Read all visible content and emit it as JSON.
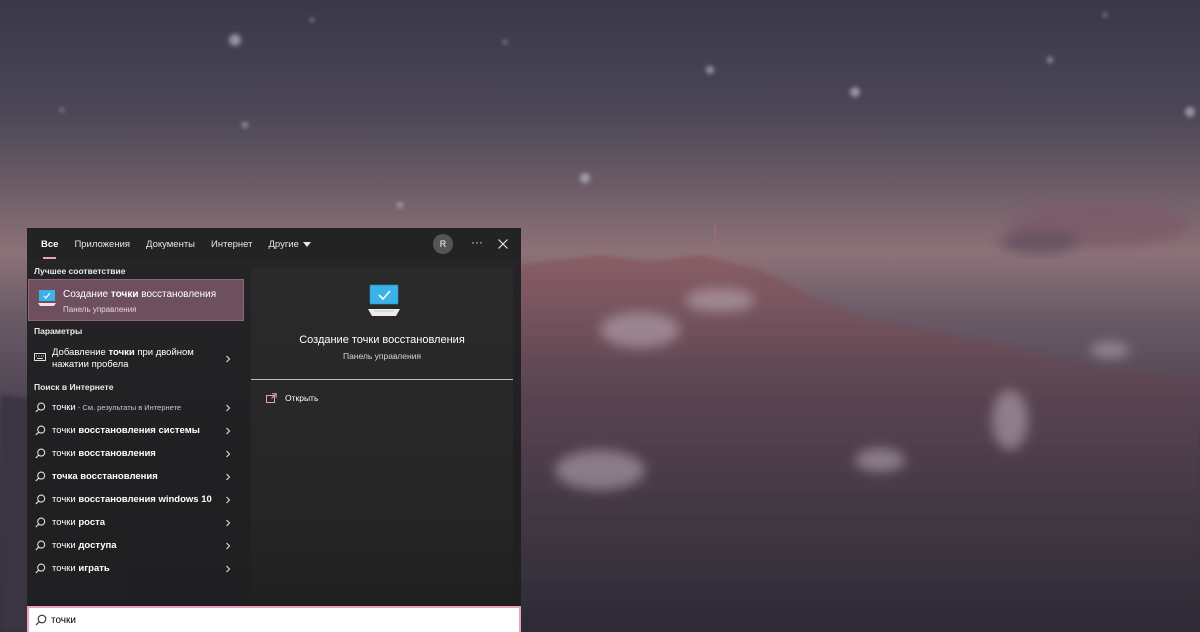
{
  "tabs": [
    {
      "label": "Все",
      "active": true
    },
    {
      "label": "Приложения",
      "active": false
    },
    {
      "label": "Документы",
      "active": false
    },
    {
      "label": "Интернет",
      "active": false
    },
    {
      "label": "Другие",
      "active": false
    }
  ],
  "account": {
    "initial": "R"
  },
  "more_label": "···",
  "icons": {
    "close": "close-icon",
    "search": "search-icon",
    "chevron": "chevron-right-icon"
  },
  "colors": {
    "accent": "#e7a2bd",
    "selected": "#6d4f5e",
    "panel": "#1e1e20",
    "monitor": "#3bb3ea"
  },
  "best_match": {
    "header": "Лучшее соответствие",
    "title_pre": "Создание ",
    "title_bold": "точки",
    "title_post": " восстановления",
    "subtitle": "Панель управления"
  },
  "settings": {
    "header": "Параметры",
    "item": {
      "pre": "Добавление ",
      "bold": "точки",
      "post": " при двойном нажатии пробела"
    }
  },
  "web": {
    "header": "Поиск в Интернете",
    "items": [
      {
        "normal": "точки",
        "bold": "",
        "dim": " - См. результаты в Интернете"
      },
      {
        "normal": "точки ",
        "bold": "восстановления системы",
        "dim": ""
      },
      {
        "normal": "точки ",
        "bold": "восстановления",
        "dim": ""
      },
      {
        "normal": "",
        "bold": "точка восстановления",
        "dim": ""
      },
      {
        "normal": "точки ",
        "bold": "восстановления windows 10",
        "dim": ""
      },
      {
        "normal": "точки ",
        "bold": "роста",
        "dim": ""
      },
      {
        "normal": "точки ",
        "bold": "доступа",
        "dim": ""
      },
      {
        "normal": "точки ",
        "bold": "играть",
        "dim": ""
      }
    ]
  },
  "preview": {
    "title": "Создание точки восстановления",
    "subtitle": "Панель управления",
    "action": "Открыть"
  },
  "search": {
    "value": "точки",
    "placeholder": ""
  }
}
